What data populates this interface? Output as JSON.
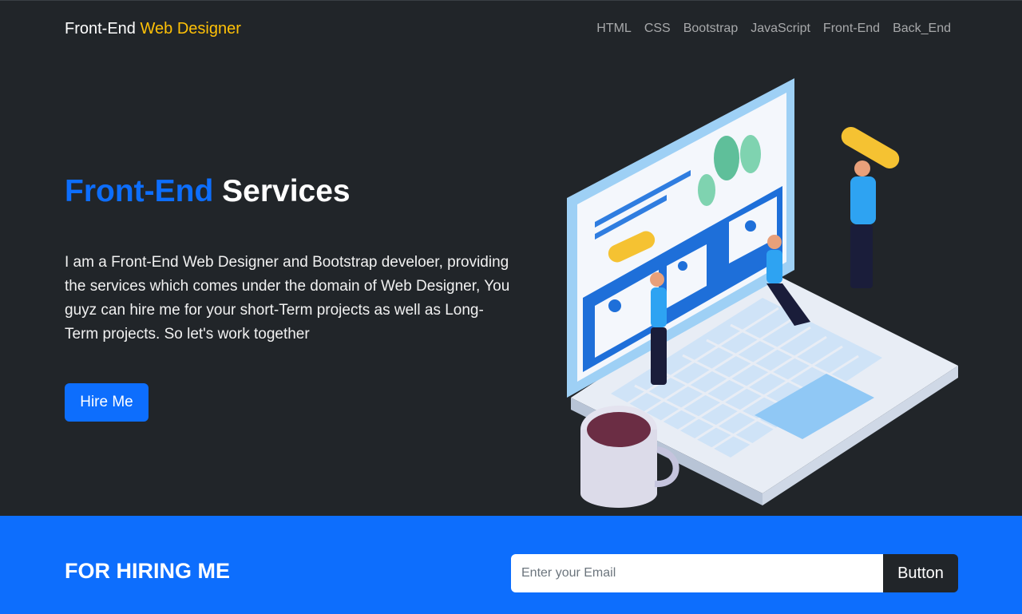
{
  "navbar": {
    "brand_main": "Front-End",
    "brand_accent": "Web Designer",
    "links": [
      "HTML",
      "CSS",
      "Bootstrap",
      "JavaScript",
      "Front-End",
      "Back_End"
    ]
  },
  "hero": {
    "title_blue": "Front-End",
    "title_white": "Services",
    "description": "I am a Front-End Web Designer and Bootstrap develoer, providing the services which comes under the domain of Web Designer, You guyz can hire me for your short-Term projects as well as Long-Term projects. So let's work together",
    "cta_label": "Hire Me"
  },
  "footer": {
    "title": "FOR HIRING ME",
    "email_placeholder": "Enter your Email",
    "button_label": "Button"
  },
  "colors": {
    "background": "#212529",
    "primary": "#0d6efd",
    "accent": "#ffc107"
  }
}
